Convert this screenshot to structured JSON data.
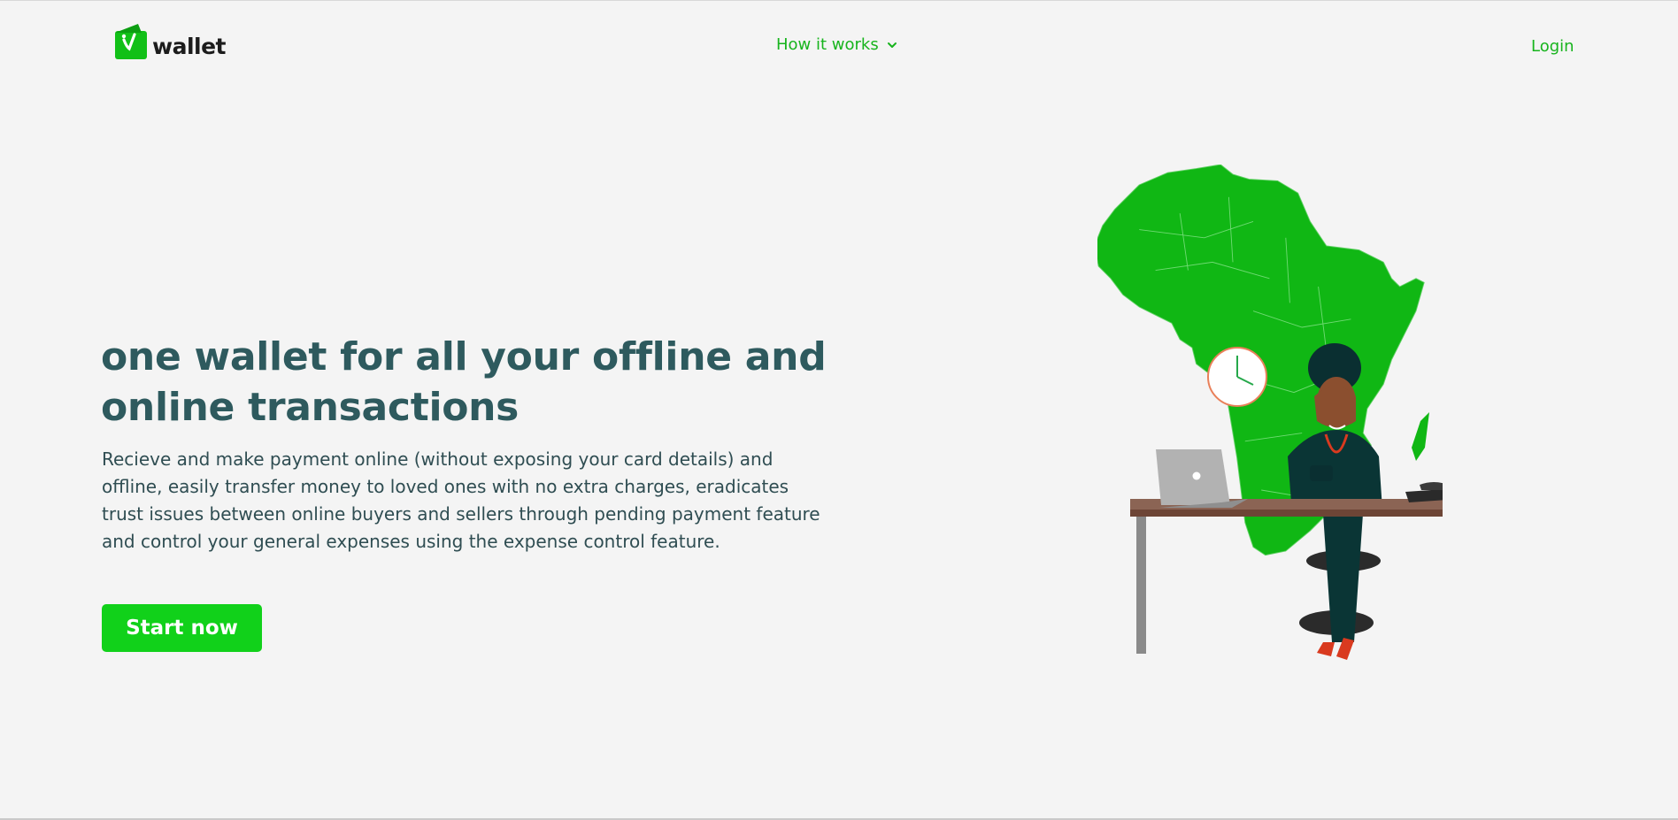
{
  "header": {
    "logo_text": "wallet",
    "logo_icon": "wallet-logo-icon",
    "nav": {
      "how_it_works": "How it works",
      "login": "Login"
    }
  },
  "hero": {
    "title": "one wallet for all your offline and online transactions",
    "description": "Recieve and make payment online (without exposing your card details) and offline, easily transfer money to loved ones with no extra charges, eradicates trust issues between online buyers and sellers through pending payment feature and control your general expenses using the expense control feature.",
    "cta": "Start now"
  },
  "colors": {
    "brand_green": "#11d11a",
    "link_green": "#17b41d",
    "heading": "#2e5a5e",
    "background": "#f4f4f4"
  }
}
